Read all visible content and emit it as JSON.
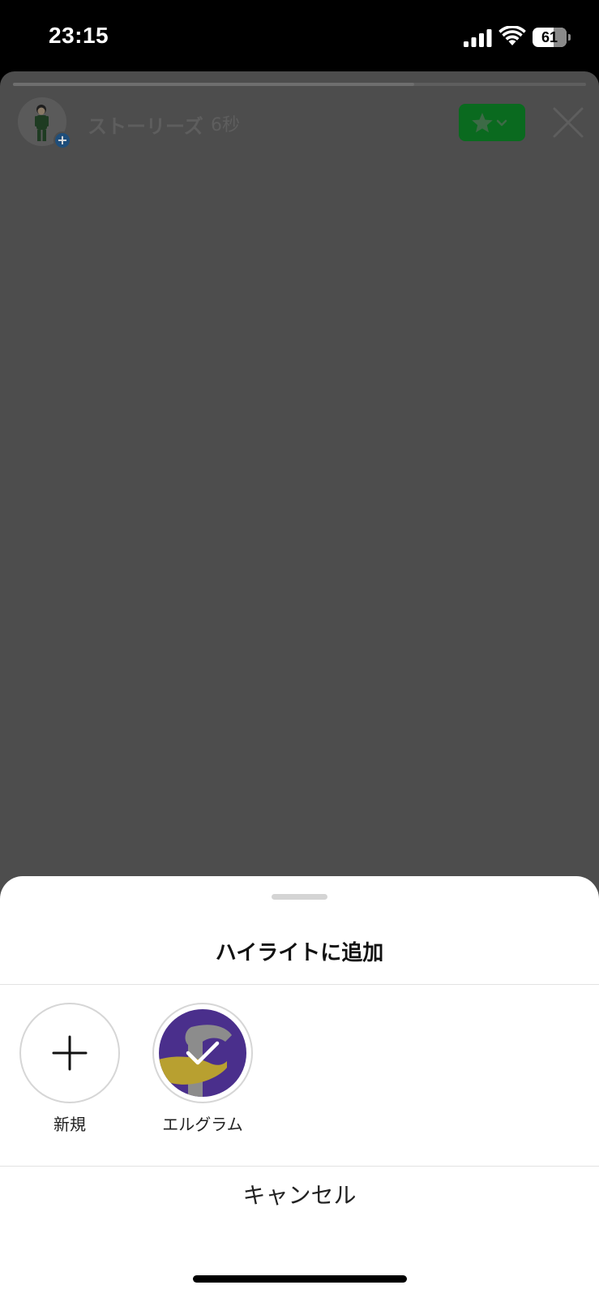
{
  "status_bar": {
    "time": "23:15",
    "battery_level": "61",
    "battery_fraction": 0.61
  },
  "story": {
    "title": "ストーリーズ",
    "elapsed": "6秒",
    "progress": 0.7,
    "favorite_color": "#0a6a1f"
  },
  "sheet": {
    "title": "ハイライトに追加",
    "highlights": [
      {
        "label": "新規",
        "icon": "plus-icon"
      },
      {
        "label": "エルグラム",
        "icon": "checkmark-icon",
        "selected": true
      }
    ],
    "cancel_label": "キャンセル"
  },
  "colors": {
    "background_dim": "#4d4d4d",
    "sheet": "#ffffff",
    "highlight_purple": "#4a2f8c",
    "highlight_gold": "#b8a030"
  }
}
